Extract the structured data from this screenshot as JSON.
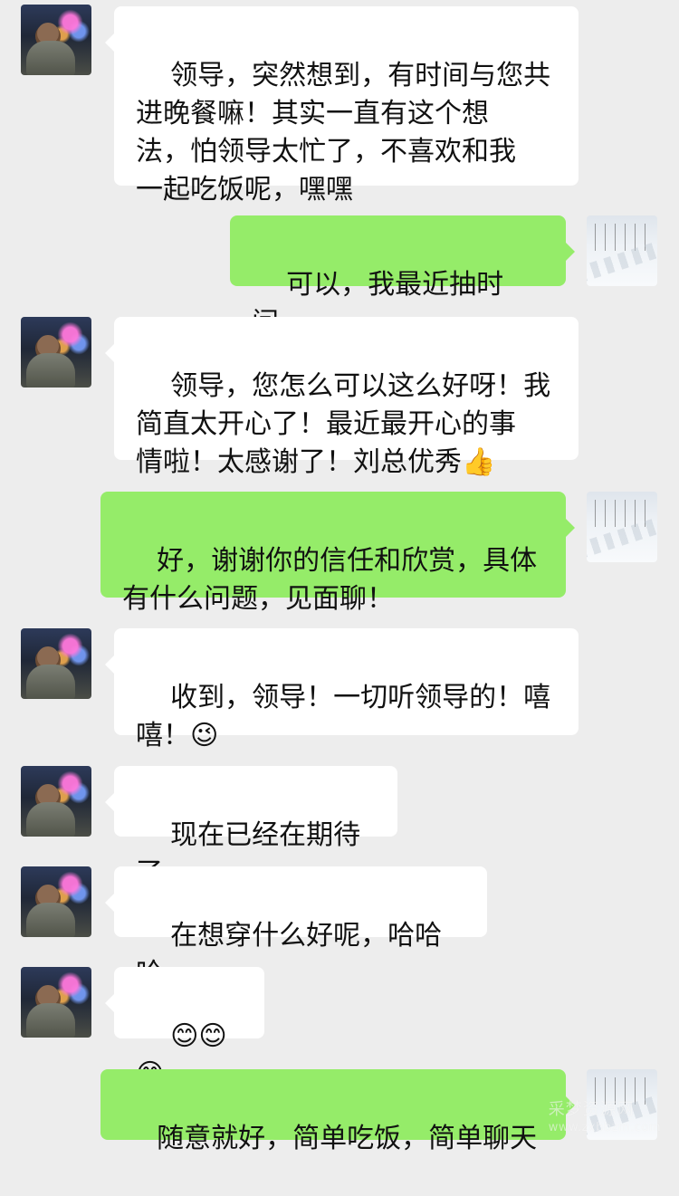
{
  "messages": [
    {
      "side": "left",
      "text": "领导，突然想到，有时间与您共\n进晚餐嘛！其实一直有这个想\n法，怕领导太忙了，不喜欢和我\n一起吃饭呢，嘿嘿"
    },
    {
      "side": "right",
      "text": "可以，我最近抽时间。"
    },
    {
      "side": "left",
      "text": "领导，您怎么可以这么好呀！我\n简直太开心了！最近最开心的事\n情啦！太感谢了！刘总优秀👍"
    },
    {
      "side": "right",
      "text": "好，谢谢你的信任和欣赏，具体\n有什么问题，见面聊！"
    },
    {
      "side": "left",
      "text": "收到，领导！一切听领导的！嘻\n嘻！😉"
    },
    {
      "side": "left",
      "text": "现在已经在期待了"
    },
    {
      "side": "left",
      "text": "在想穿什么好呢，哈哈哈"
    },
    {
      "side": "left",
      "text": "😊😊😊"
    },
    {
      "side": "right",
      "text": "随意就好，简单吃饭，简单聊天"
    }
  ],
  "watermark": {
    "title": "采梦资源网",
    "url": "www.zxbbzm.com"
  }
}
